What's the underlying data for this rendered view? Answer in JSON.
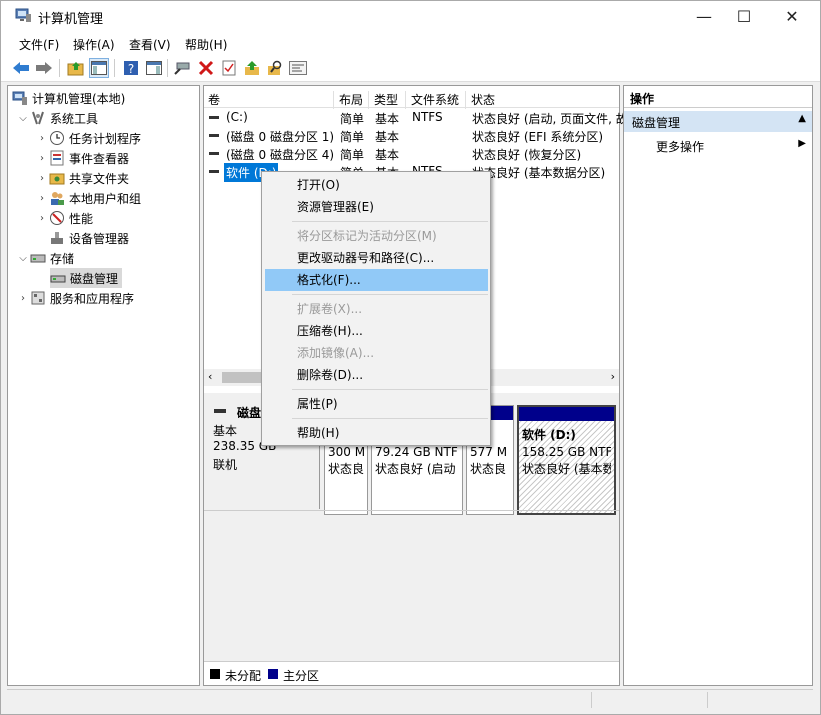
{
  "window": {
    "title": "计算机管理",
    "minimize": "—",
    "maximize": "☐",
    "close": "✕"
  },
  "menu": [
    "文件(F)",
    "操作(A)",
    "查看(V)",
    "帮助(H)"
  ],
  "tree": {
    "root": "计算机管理(本地)",
    "system_tools": "系统工具",
    "task_scheduler": "任务计划程序",
    "event_viewer": "事件查看器",
    "shared_folders": "共享文件夹",
    "local_users": "本地用户和组",
    "performance": "性能",
    "device_manager": "设备管理器",
    "storage": "存储",
    "disk_management": "磁盘管理",
    "services_apps": "服务和应用程序"
  },
  "volume_list": {
    "headers": [
      "卷",
      "布局",
      "类型",
      "文件系统",
      "状态"
    ],
    "rows": [
      [
        "(C:)",
        "简单",
        "基本",
        "NTFS",
        "状态良好 (启动, 页面文件, 故"
      ],
      [
        "(磁盘 0 磁盘分区 1)",
        "简单",
        "基本",
        "",
        "状态良好 (EFI 系统分区)"
      ],
      [
        "(磁盘 0 磁盘分区 4)",
        "简单",
        "基本",
        "",
        "状态良好 (恢复分区)"
      ],
      [
        "软件 (D:)",
        "简单",
        "基本",
        "NTFS",
        "状态良好 (基本数据分区)"
      ]
    ]
  },
  "disk": {
    "name": "磁盘",
    "type": "基本",
    "size": "238.35 GB",
    "status": "联机",
    "partitions": [
      {
        "size": "300 M",
        "status": "状态良"
      },
      {
        "size": "79.24 GB NTF",
        "status": "状态良好 (启动"
      },
      {
        "size": "577 M",
        "status": "状态良"
      },
      {
        "label": "软件  (D:)",
        "size": "158.25 GB NTF",
        "status": "状态良好 (基本数"
      }
    ]
  },
  "legend": {
    "unallocated": "未分配",
    "primary": "主分区"
  },
  "actions": {
    "header": "操作",
    "section": "磁盘管理",
    "more": "更多操作"
  },
  "context_menu": {
    "open": "打开(O)",
    "explorer": "资源管理器(E)",
    "mark_active": "将分区标记为活动分区(M)",
    "change_letter": "更改驱动器号和路径(C)...",
    "format": "格式化(F)...",
    "extend": "扩展卷(X)...",
    "shrink": "压缩卷(H)...",
    "add_mirror": "添加镜像(A)...",
    "delete": "删除卷(D)...",
    "properties": "属性(P)",
    "help": "帮助(H)"
  },
  "colors": {
    "selected_row": "#0078d7",
    "menu_highlight": "#91c9f7",
    "primary_partition": "#00008b",
    "actions_header": "#d4e4f4"
  }
}
